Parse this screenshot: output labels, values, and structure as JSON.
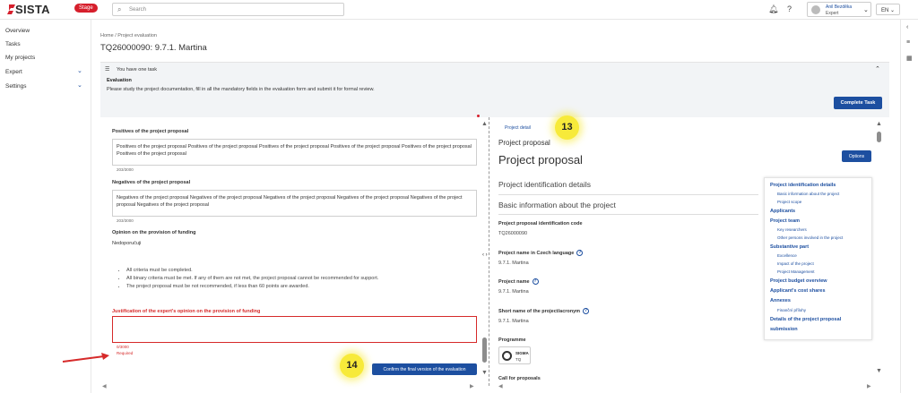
{
  "topbar": {
    "logo": "SISTA",
    "stage": "Stage",
    "search_placeholder": "Search",
    "user_name": "Anil Bezděka",
    "user_role": "Expert",
    "language": "EN"
  },
  "sidebar": {
    "items": [
      {
        "label": "Overview"
      },
      {
        "label": "Tasks"
      },
      {
        "label": "My projects"
      },
      {
        "label": "Expert"
      },
      {
        "label": "Settings"
      }
    ]
  },
  "header": {
    "breadcrumb": "Home / Project evaluation",
    "title": "TQ26000090: 9.7.1. Martina"
  },
  "task": {
    "summary": "You have one task",
    "title": "Evaluation",
    "description": "Please study the project documentation, fill in all the mandatory fields in the evaluation form and submit it for formal review.",
    "complete_button": "Complete Task"
  },
  "form": {
    "positives_label": "Positives of the project proposal",
    "positives_value": "Positives of the project proposal Positives of the project proposal Positives of the project proposal Positives of the project proposal Positives of the project proposal Positives of the project proposal",
    "positives_count": "203/3000",
    "negatives_label": "Negatives of the project proposal",
    "negatives_value": "Negatives of the project proposal Negatives of the project proposal Negatives of the project proposal Negatives of the project proposal Negatives of the project proposal Negatives of the project proposal",
    "negatives_count": "203/3000",
    "opinion_label": "Opinion on the provision of funding",
    "opinion_value": "Nedoporučuji",
    "rules": [
      "All criteria must be completed.",
      "All binary criteria must be met. If any of them are not met, the project proposal cannot be recommended for support.",
      "The project proposal must be not recommended, if less than 60 points are awarded."
    ],
    "justification_label": "Justification of the expert's opinion on the provision of funding",
    "justification_value": "",
    "justification_count": "0/3000",
    "required_text": "Required",
    "confirm_button": "Confirm the final version of the evaluation"
  },
  "detail": {
    "link": "Project detail",
    "subtitle": "Project proposal",
    "title": "Project proposal",
    "options_button": "Options",
    "section1": "Project identification details",
    "section2": "Basic information about the project",
    "fields": [
      {
        "label": "Project proposal identification code",
        "value": "TQ26000090",
        "help": false
      },
      {
        "label": "Project name in Czech language",
        "value": "9.7.1. Martina",
        "help": true
      },
      {
        "label": "Project name",
        "value": "9.7.1. Martina",
        "help": true
      },
      {
        "label": "Short name of the project/acronym",
        "value": "9.7.1. Martina",
        "help": true
      }
    ],
    "programme_label": "Programme",
    "programme_name": "SIGMA",
    "programme_code": "TQ",
    "next_label_cut": "Call for proposals"
  },
  "toc": [
    {
      "label": "Project identification details",
      "sub": false
    },
    {
      "label": "Basic information about the project",
      "sub": true
    },
    {
      "label": "Project scope",
      "sub": true
    },
    {
      "label": "Applicants",
      "sub": false
    },
    {
      "label": "Project team",
      "sub": false
    },
    {
      "label": "Key researchers",
      "sub": true
    },
    {
      "label": "Other persons involved in the project",
      "sub": true
    },
    {
      "label": "Substantive part",
      "sub": false
    },
    {
      "label": "Excellence",
      "sub": true
    },
    {
      "label": "Impact of the project",
      "sub": true
    },
    {
      "label": "Project Management",
      "sub": true
    },
    {
      "label": "Project budget overview",
      "sub": false
    },
    {
      "label": "Applicant's cost shares",
      "sub": false
    },
    {
      "label": "Annexes",
      "sub": false
    },
    {
      "label": "Finanční přílohy",
      "sub": true
    },
    {
      "label": "Details of the project proposal",
      "sub": false
    },
    {
      "label": "submission",
      "sub": false
    }
  ],
  "annotations": {
    "badge_13": "13",
    "badge_14": "14"
  },
  "colors": {
    "primary": "#1d4fa0",
    "stage": "#d61f2c",
    "error": "#d62a2a",
    "highlight": "#f7ea3a"
  }
}
